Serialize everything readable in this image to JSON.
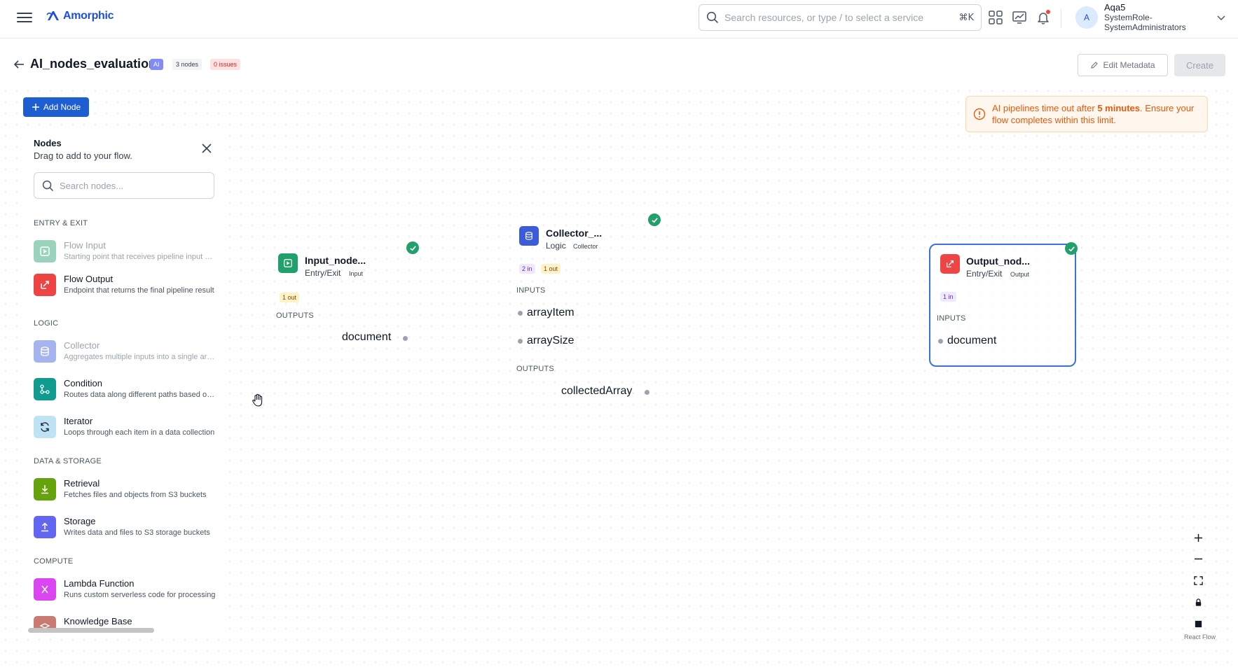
{
  "app": {
    "logo_text": "Amorphic",
    "brand_color": "#1d4ed8"
  },
  "search": {
    "placeholder": "Search resources, or type / to select a service",
    "shortcut": "⌘K"
  },
  "user": {
    "avatar_letter": "A",
    "name": "Aqa5",
    "role_line1": "SystemRole-",
    "role_line2": "SystemAdministrators"
  },
  "header": {
    "title": "AI_nodes_evaluation",
    "badge_ai": "AI",
    "badge_nodes": "3 nodes",
    "badge_issues": "0 issues",
    "edit_metadata_label": "Edit Metadata",
    "create_label": "Create"
  },
  "toolbar": {
    "add_node_label": "Add Node"
  },
  "alert": {
    "text_before": "AI pipelines time out after ",
    "text_bold": "5 minutes",
    "text_after": ". Ensure your flow completes within this limit."
  },
  "panel": {
    "title": "Nodes",
    "subtitle": "Drag to add to your flow.",
    "search_placeholder": "Search nodes...",
    "categories": {
      "entry_exit": "ENTRY & EXIT",
      "logic": "LOGIC",
      "data_storage": "DATA & STORAGE",
      "compute": "COMPUTE"
    },
    "items": {
      "flow_input": {
        "name": "Flow Input",
        "desc": "Starting point that receives pipeline input data"
      },
      "flow_output": {
        "name": "Flow Output",
        "desc": "Endpoint that returns the final pipeline result"
      },
      "collector": {
        "name": "Collector",
        "desc": "Aggregates multiple inputs into a single array"
      },
      "condition": {
        "name": "Condition",
        "desc": "Routes data along different paths based on rules"
      },
      "iterator": {
        "name": "Iterator",
        "desc": "Loops through each item in a data collection"
      },
      "retrieval": {
        "name": "Retrieval",
        "desc": "Fetches files and objects from S3 buckets"
      },
      "storage": {
        "name": "Storage",
        "desc": "Writes data and files to S3 storage buckets"
      },
      "lambda": {
        "name": "Lambda Function",
        "desc": "Runs custom serverless code for processing"
      },
      "knowledge_base": {
        "name": "Knowledge Base",
        "desc": ""
      }
    }
  },
  "flow": {
    "input_node": {
      "title": "Input_node...",
      "category": "Entry/Exit",
      "type": "Input",
      "out_count": "1 out",
      "outputs_label": "OUTPUTS",
      "outputs": [
        "document"
      ]
    },
    "collector_node": {
      "title": "Collector_...",
      "category": "Logic",
      "type": "Collector",
      "in_count": "2 in",
      "out_count": "1 out",
      "inputs_label": "INPUTS",
      "inputs": [
        "arrayItem",
        "arraySize"
      ],
      "outputs_label": "OUTPUTS",
      "outputs": [
        "collectedArray"
      ]
    },
    "output_node": {
      "title": "Output_nod...",
      "category": "Entry/Exit",
      "type": "Output",
      "in_count": "1 in",
      "inputs_label": "INPUTS",
      "inputs": [
        "document"
      ]
    }
  },
  "controls": {
    "attribution": "React Flow"
  },
  "colors": {
    "success": "#22a06b",
    "flow_input": "#22a06b",
    "flow_output": "#ef4444",
    "collector": "#3b5bdb",
    "condition": "#0f9b8e",
    "iterator": "#bfe3f5",
    "retrieval": "#65a30d",
    "storage": "#6366f1",
    "lambda": "#d946ef",
    "knowledge_base": "#c97b72"
  }
}
